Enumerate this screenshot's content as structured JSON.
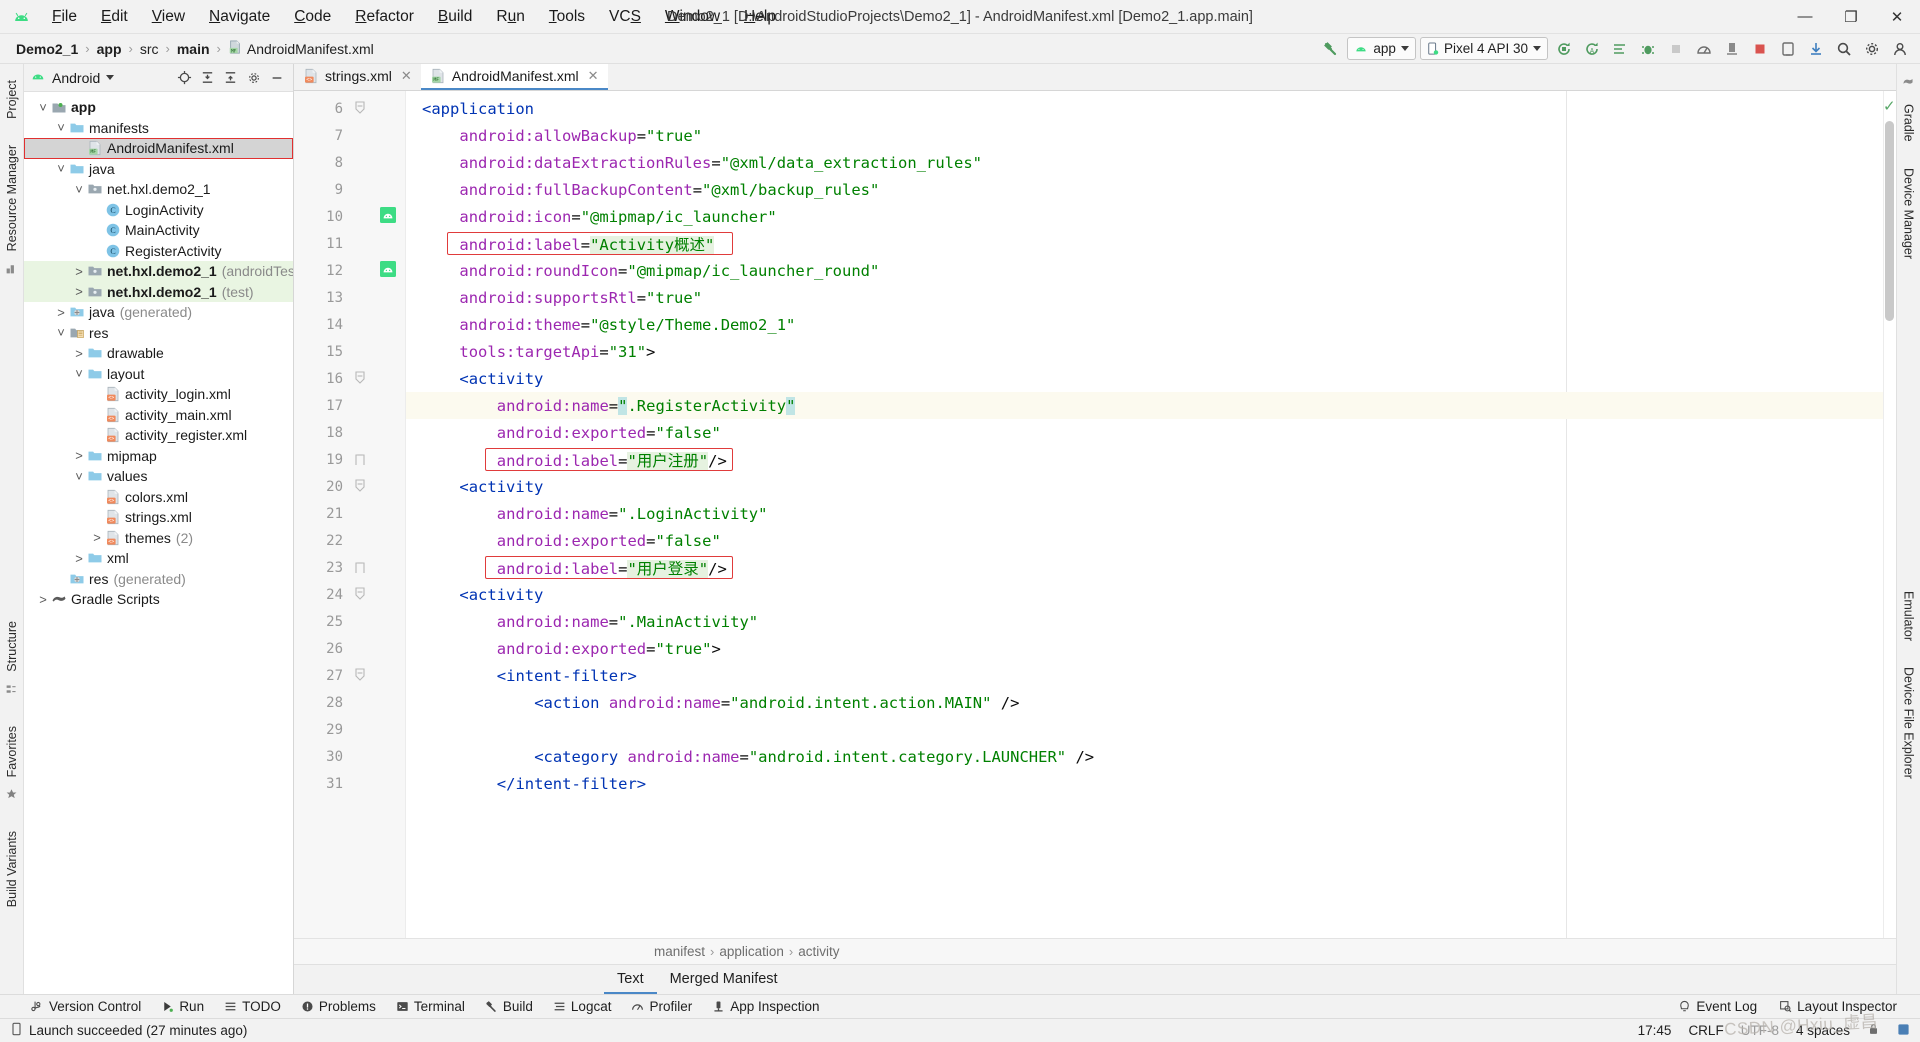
{
  "window": {
    "title": "Demo2_1 [D:\\AndroidStudioProjects\\Demo2_1] - AndroidManifest.xml [Demo2_1.app.main]",
    "minimize": "—",
    "maximize": "❐",
    "close": "✕"
  },
  "menubar": {
    "items": [
      {
        "label": "File"
      },
      {
        "label": "Edit"
      },
      {
        "label": "View"
      },
      {
        "label": "Navigate"
      },
      {
        "label": "Code"
      },
      {
        "label": "Refactor"
      },
      {
        "label": "Build"
      },
      {
        "label": "Run"
      },
      {
        "label": "Tools"
      },
      {
        "label": "VCS"
      },
      {
        "label": "Window"
      },
      {
        "label": "Help"
      }
    ]
  },
  "breadcrumb": {
    "items": [
      "Demo2_1",
      "app",
      "src",
      "main",
      "AndroidManifest.xml"
    ]
  },
  "toolbar": {
    "run_config": "app",
    "device": "Pixel 4 API 30"
  },
  "project_panel": {
    "title": "Android",
    "tree": [
      {
        "indent": 0,
        "arrow": "v",
        "icon": "module-icon",
        "label": "app",
        "bold": true,
        "suffix": "",
        "state": "normal"
      },
      {
        "indent": 1,
        "arrow": "v",
        "icon": "folder-icon",
        "label": "manifests",
        "bold": false,
        "suffix": "",
        "state": "normal"
      },
      {
        "indent": 2,
        "arrow": "",
        "icon": "manifest-file-icon",
        "label": "AndroidManifest.xml",
        "bold": false,
        "suffix": "",
        "state": "selected"
      },
      {
        "indent": 1,
        "arrow": "v",
        "icon": "folder-icon",
        "label": "java",
        "bold": false,
        "suffix": "",
        "state": "normal"
      },
      {
        "indent": 2,
        "arrow": "v",
        "icon": "package-icon",
        "label": "net.hxl.demo2_1",
        "bold": false,
        "suffix": "",
        "state": "normal"
      },
      {
        "indent": 3,
        "arrow": "",
        "icon": "class-icon",
        "label": "LoginActivity",
        "bold": false,
        "suffix": "",
        "state": "normal"
      },
      {
        "indent": 3,
        "arrow": "",
        "icon": "class-icon",
        "label": "MainActivity",
        "bold": false,
        "suffix": "",
        "state": "normal"
      },
      {
        "indent": 3,
        "arrow": "",
        "icon": "class-icon",
        "label": "RegisterActivity",
        "bold": false,
        "suffix": "",
        "state": "normal"
      },
      {
        "indent": 2,
        "arrow": ">",
        "icon": "package-icon",
        "label": "net.hxl.demo2_1",
        "bold": true,
        "suffix": "(androidTest)",
        "state": "green"
      },
      {
        "indent": 2,
        "arrow": ">",
        "icon": "package-icon",
        "label": "net.hxl.demo2_1",
        "bold": true,
        "suffix": "(test)",
        "state": "green"
      },
      {
        "indent": 1,
        "arrow": ">",
        "icon": "generated-icon",
        "label": "java",
        "bold": false,
        "suffix": "(generated)",
        "state": "normal"
      },
      {
        "indent": 1,
        "arrow": "v",
        "icon": "res-icon",
        "label": "res",
        "bold": false,
        "suffix": "",
        "state": "normal"
      },
      {
        "indent": 2,
        "arrow": ">",
        "icon": "folder-icon",
        "label": "drawable",
        "bold": false,
        "suffix": "",
        "state": "normal"
      },
      {
        "indent": 2,
        "arrow": "v",
        "icon": "folder-icon",
        "label": "layout",
        "bold": false,
        "suffix": "",
        "state": "normal"
      },
      {
        "indent": 3,
        "arrow": "",
        "icon": "xml-file-icon",
        "label": "activity_login.xml",
        "bold": false,
        "suffix": "",
        "state": "normal"
      },
      {
        "indent": 3,
        "arrow": "",
        "icon": "xml-file-icon",
        "label": "activity_main.xml",
        "bold": false,
        "suffix": "",
        "state": "normal"
      },
      {
        "indent": 3,
        "arrow": "",
        "icon": "xml-file-icon",
        "label": "activity_register.xml",
        "bold": false,
        "suffix": "",
        "state": "normal"
      },
      {
        "indent": 2,
        "arrow": ">",
        "icon": "folder-icon",
        "label": "mipmap",
        "bold": false,
        "suffix": "",
        "state": "normal"
      },
      {
        "indent": 2,
        "arrow": "v",
        "icon": "folder-icon",
        "label": "values",
        "bold": false,
        "suffix": "",
        "state": "normal"
      },
      {
        "indent": 3,
        "arrow": "",
        "icon": "xml-file-icon",
        "label": "colors.xml",
        "bold": false,
        "suffix": "",
        "state": "normal"
      },
      {
        "indent": 3,
        "arrow": "",
        "icon": "xml-file-icon",
        "label": "strings.xml",
        "bold": false,
        "suffix": "",
        "state": "normal"
      },
      {
        "indent": 3,
        "arrow": ">",
        "icon": "xml-file-icon",
        "label": "themes",
        "bold": false,
        "suffix": "(2)",
        "state": "normal"
      },
      {
        "indent": 2,
        "arrow": ">",
        "icon": "folder-icon",
        "label": "xml",
        "bold": false,
        "suffix": "",
        "state": "normal"
      },
      {
        "indent": 1,
        "arrow": "",
        "icon": "generated-icon",
        "label": "res",
        "bold": false,
        "suffix": "(generated)",
        "state": "normal"
      },
      {
        "indent": 0,
        "arrow": ">",
        "icon": "gradle-icon",
        "label": "Gradle Scripts",
        "bold": false,
        "suffix": "",
        "state": "normal"
      }
    ]
  },
  "left_strip": {
    "tabs": [
      "Project",
      "Resource Manager",
      "Structure",
      "Favorites",
      "Build Variants"
    ]
  },
  "right_strip": {
    "tabs": [
      "Gradle",
      "Device Manager",
      "Emulator",
      "Device File Explorer"
    ]
  },
  "editor_tabs": [
    {
      "label": "strings.xml",
      "icon": "xml-file-icon",
      "active": false
    },
    {
      "label": "AndroidManifest.xml",
      "icon": "manifest-file-icon",
      "active": true
    }
  ],
  "code": {
    "first_line": 6,
    "lines": [
      {
        "n": 6,
        "indent": 0,
        "fold": "minus",
        "marker": "",
        "tokens": [
          {
            "t": "tag",
            "v": "<application"
          }
        ]
      },
      {
        "n": 7,
        "indent": 1,
        "fold": "",
        "marker": "",
        "tokens": [
          {
            "t": "attr",
            "v": "android:allowBackup"
          },
          {
            "t": "eq",
            "v": "="
          },
          {
            "t": "str",
            "v": "\"true\""
          }
        ]
      },
      {
        "n": 8,
        "indent": 1,
        "fold": "",
        "marker": "",
        "tokens": [
          {
            "t": "attr",
            "v": "android:dataExtractionRules"
          },
          {
            "t": "eq",
            "v": "="
          },
          {
            "t": "str",
            "v": "\"@xml/data_extraction_rules\""
          }
        ]
      },
      {
        "n": 9,
        "indent": 1,
        "fold": "",
        "marker": "",
        "tokens": [
          {
            "t": "attr",
            "v": "android:fullBackupContent"
          },
          {
            "t": "eq",
            "v": "="
          },
          {
            "t": "str",
            "v": "\"@xml/backup_rules\""
          }
        ]
      },
      {
        "n": 10,
        "indent": 1,
        "fold": "",
        "marker": "android",
        "tokens": [
          {
            "t": "attr",
            "v": "android:icon"
          },
          {
            "t": "eq",
            "v": "="
          },
          {
            "t": "str",
            "v": "\"@mipmap/ic_launcher\""
          }
        ]
      },
      {
        "n": 11,
        "indent": 1,
        "fold": "",
        "marker": "",
        "box": true,
        "tokens": [
          {
            "t": "attr",
            "v": "android:label"
          },
          {
            "t": "eq",
            "v": "="
          },
          {
            "t": "str-green",
            "v": "\"Activity概述\""
          }
        ]
      },
      {
        "n": 12,
        "indent": 1,
        "fold": "",
        "marker": "android",
        "tokens": [
          {
            "t": "attr",
            "v": "android:roundIcon"
          },
          {
            "t": "eq",
            "v": "="
          },
          {
            "t": "str",
            "v": "\"@mipmap/ic_launcher_round\""
          }
        ]
      },
      {
        "n": 13,
        "indent": 1,
        "fold": "",
        "marker": "",
        "tokens": [
          {
            "t": "attr",
            "v": "android:supportsRtl"
          },
          {
            "t": "eq",
            "v": "="
          },
          {
            "t": "str",
            "v": "\"true\""
          }
        ]
      },
      {
        "n": 14,
        "indent": 1,
        "fold": "",
        "marker": "",
        "tokens": [
          {
            "t": "attr",
            "v": "android:theme"
          },
          {
            "t": "eq",
            "v": "="
          },
          {
            "t": "str",
            "v": "\"@style/Theme.Demo2_1\""
          }
        ]
      },
      {
        "n": 15,
        "indent": 1,
        "fold": "",
        "marker": "",
        "tokens": [
          {
            "t": "attr",
            "v": "tools:targetApi"
          },
          {
            "t": "eq",
            "v": "="
          },
          {
            "t": "str",
            "v": "\"31\""
          },
          {
            "t": "plain",
            "v": ">"
          }
        ]
      },
      {
        "n": 16,
        "indent": 1,
        "fold": "minus",
        "marker": "",
        "tokens": [
          {
            "t": "tag",
            "v": "<activity"
          }
        ]
      },
      {
        "n": 17,
        "indent": 2,
        "fold": "",
        "marker": "",
        "hl": true,
        "tokens": [
          {
            "t": "attr",
            "v": "android:name"
          },
          {
            "t": "eq",
            "v": "="
          },
          {
            "t": "sel",
            "v": "\""
          },
          {
            "t": "str",
            "v": ".RegisterActivity"
          },
          {
            "t": "sel",
            "v": "\""
          }
        ]
      },
      {
        "n": 18,
        "indent": 2,
        "fold": "",
        "marker": "",
        "tokens": [
          {
            "t": "attr",
            "v": "android:exported"
          },
          {
            "t": "eq",
            "v": "="
          },
          {
            "t": "str",
            "v": "\"false\""
          }
        ]
      },
      {
        "n": 19,
        "indent": 2,
        "fold": "end",
        "marker": "",
        "box": true,
        "tokens": [
          {
            "t": "attr",
            "v": "android:label"
          },
          {
            "t": "eq",
            "v": "="
          },
          {
            "t": "str-green",
            "v": "\"用户注册\""
          },
          {
            "t": "plain",
            "v": "/>"
          }
        ]
      },
      {
        "n": 20,
        "indent": 1,
        "fold": "minus",
        "marker": "",
        "tokens": [
          {
            "t": "tag",
            "v": "<activity"
          }
        ]
      },
      {
        "n": 21,
        "indent": 2,
        "fold": "",
        "marker": "",
        "tokens": [
          {
            "t": "attr",
            "v": "android:name"
          },
          {
            "t": "eq",
            "v": "="
          },
          {
            "t": "str",
            "v": "\".LoginActivity\""
          }
        ]
      },
      {
        "n": 22,
        "indent": 2,
        "fold": "",
        "marker": "",
        "tokens": [
          {
            "t": "attr",
            "v": "android:exported"
          },
          {
            "t": "eq",
            "v": "="
          },
          {
            "t": "str",
            "v": "\"false\""
          }
        ]
      },
      {
        "n": 23,
        "indent": 2,
        "fold": "end",
        "marker": "",
        "box": true,
        "tokens": [
          {
            "t": "attr",
            "v": "android:label"
          },
          {
            "t": "eq",
            "v": "="
          },
          {
            "t": "str-green",
            "v": "\"用户登录\""
          },
          {
            "t": "plain",
            "v": "/>"
          }
        ]
      },
      {
        "n": 24,
        "indent": 1,
        "fold": "minus",
        "marker": "",
        "tokens": [
          {
            "t": "tag",
            "v": "<activity"
          }
        ]
      },
      {
        "n": 25,
        "indent": 2,
        "fold": "",
        "marker": "",
        "tokens": [
          {
            "t": "attr",
            "v": "android:name"
          },
          {
            "t": "eq",
            "v": "="
          },
          {
            "t": "str",
            "v": "\".MainActivity\""
          }
        ]
      },
      {
        "n": 26,
        "indent": 2,
        "fold": "",
        "marker": "",
        "tokens": [
          {
            "t": "attr",
            "v": "android:exported"
          },
          {
            "t": "eq",
            "v": "="
          },
          {
            "t": "str",
            "v": "\"true\""
          },
          {
            "t": "plain",
            "v": ">"
          }
        ]
      },
      {
        "n": 27,
        "indent": 2,
        "fold": "minus",
        "marker": "",
        "tokens": [
          {
            "t": "tag",
            "v": "<intent-filter>"
          }
        ]
      },
      {
        "n": 28,
        "indent": 3,
        "fold": "",
        "marker": "",
        "tokens": [
          {
            "t": "tag",
            "v": "<action "
          },
          {
            "t": "attr",
            "v": "android:name"
          },
          {
            "t": "eq",
            "v": "="
          },
          {
            "t": "str",
            "v": "\"android.intent.action.MAIN\""
          },
          {
            "t": "plain",
            "v": " />"
          }
        ]
      },
      {
        "n": 29,
        "indent": 3,
        "fold": "",
        "marker": "",
        "tokens": []
      },
      {
        "n": 30,
        "indent": 3,
        "fold": "",
        "marker": "",
        "tokens": [
          {
            "t": "tag",
            "v": "<category "
          },
          {
            "t": "attr",
            "v": "android:name"
          },
          {
            "t": "eq",
            "v": "="
          },
          {
            "t": "str",
            "v": "\"android.intent.category.LAUNCHER\""
          },
          {
            "t": "plain",
            "v": " />"
          }
        ]
      },
      {
        "n": 31,
        "indent": 2,
        "fold": "",
        "marker": "",
        "tokens": [
          {
            "t": "tag",
            "v": "</intent-filter>"
          }
        ]
      }
    ]
  },
  "editor_breadcrumbs": [
    "manifest",
    "application",
    "activity"
  ],
  "editor_bottom_tabs": [
    {
      "label": "Text",
      "active": true
    },
    {
      "label": "Merged Manifest",
      "active": false
    }
  ],
  "toolwindow_bar": {
    "items": [
      {
        "label": "Version Control",
        "icon": "branch-icon"
      },
      {
        "label": "Run",
        "icon": "run-icon"
      },
      {
        "label": "TODO",
        "icon": "list-icon"
      },
      {
        "label": "Problems",
        "icon": "warning-icon"
      },
      {
        "label": "Terminal",
        "icon": "terminal-icon"
      },
      {
        "label": "Build",
        "icon": "hammer-icon"
      },
      {
        "label": "Logcat",
        "icon": "logcat-icon"
      },
      {
        "label": "Profiler",
        "icon": "profiler-icon"
      },
      {
        "label": "App Inspection",
        "icon": "inspection-icon"
      }
    ],
    "right_items": [
      {
        "label": "Event Log",
        "icon": "event-log-icon"
      },
      {
        "label": "Layout Inspector",
        "icon": "layout-inspector-icon"
      }
    ]
  },
  "statusbar": {
    "message": "Launch succeeded (27 minutes ago)",
    "time": "17:45",
    "line_sep": "CRLF",
    "encoding": "UTF-8",
    "indent": "4 spaces"
  },
  "watermark": "CSDN @Hxiu_虚昌",
  "colors": {
    "accent": "#4a88c7",
    "tag": "#0033b3",
    "attr": "#9c27b0",
    "string": "#008000",
    "highlight_box": "#e03b3b",
    "selection": "#c0e5e5",
    "green_bg": "#e6f2e0",
    "android_green": "#3ddc84"
  }
}
